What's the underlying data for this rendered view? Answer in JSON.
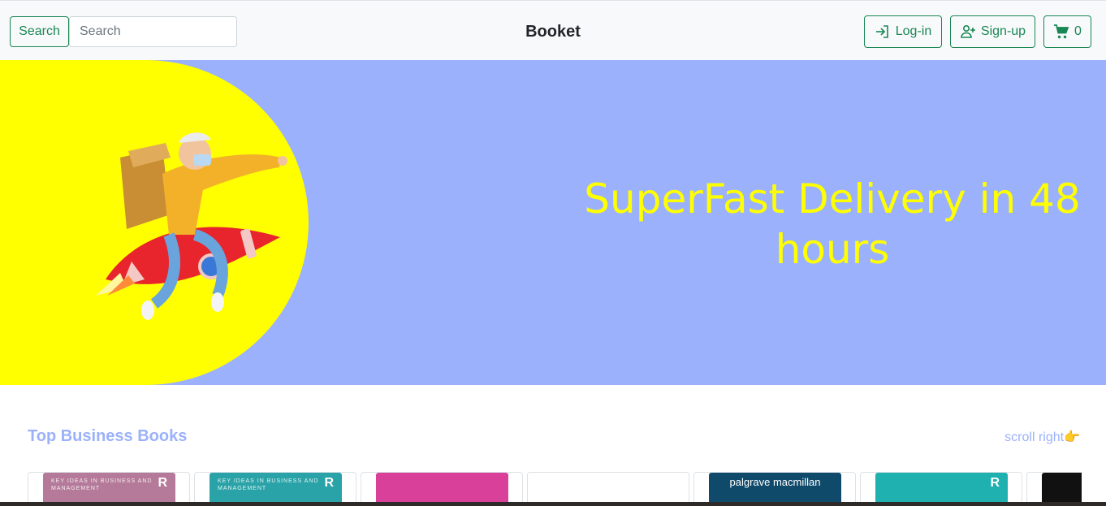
{
  "navbar": {
    "search_button": "Search",
    "search_placeholder": "Search",
    "brand": "Booket",
    "login_label": "Log-in",
    "signup_label": "Sign-up",
    "cart_count": "0"
  },
  "hero": {
    "headline": "SuperFast Delivery in 48 hours"
  },
  "section": {
    "title": "Top Business Books",
    "scroll_hint": "scroll right👉"
  },
  "books": [
    {
      "cover_color": "#b57a99",
      "cover_text": "KEY IDEAS IN BUSINESS AND MANAGEMENT",
      "badge": "R"
    },
    {
      "cover_color": "#2aa3a8",
      "cover_text": "KEY IDEAS IN BUSINESS AND MANAGEMENT",
      "badge": "R"
    },
    {
      "cover_color": "#d8409a",
      "cover_text": "",
      "badge": ""
    },
    {
      "cover_color": "#ffffff",
      "cover_text": "",
      "badge": ""
    },
    {
      "cover_color": "#0f4a6b",
      "cover_text": "palgrave macmillan",
      "badge": ""
    },
    {
      "cover_color": "#1fb0b0",
      "cover_text": "",
      "badge": "R"
    },
    {
      "cover_color": "#111111",
      "cover_text": "",
      "badge": ""
    }
  ],
  "colors": {
    "accent": "#198754",
    "hero_bg": "#9bb1fc",
    "hero_text": "#ffff00"
  }
}
